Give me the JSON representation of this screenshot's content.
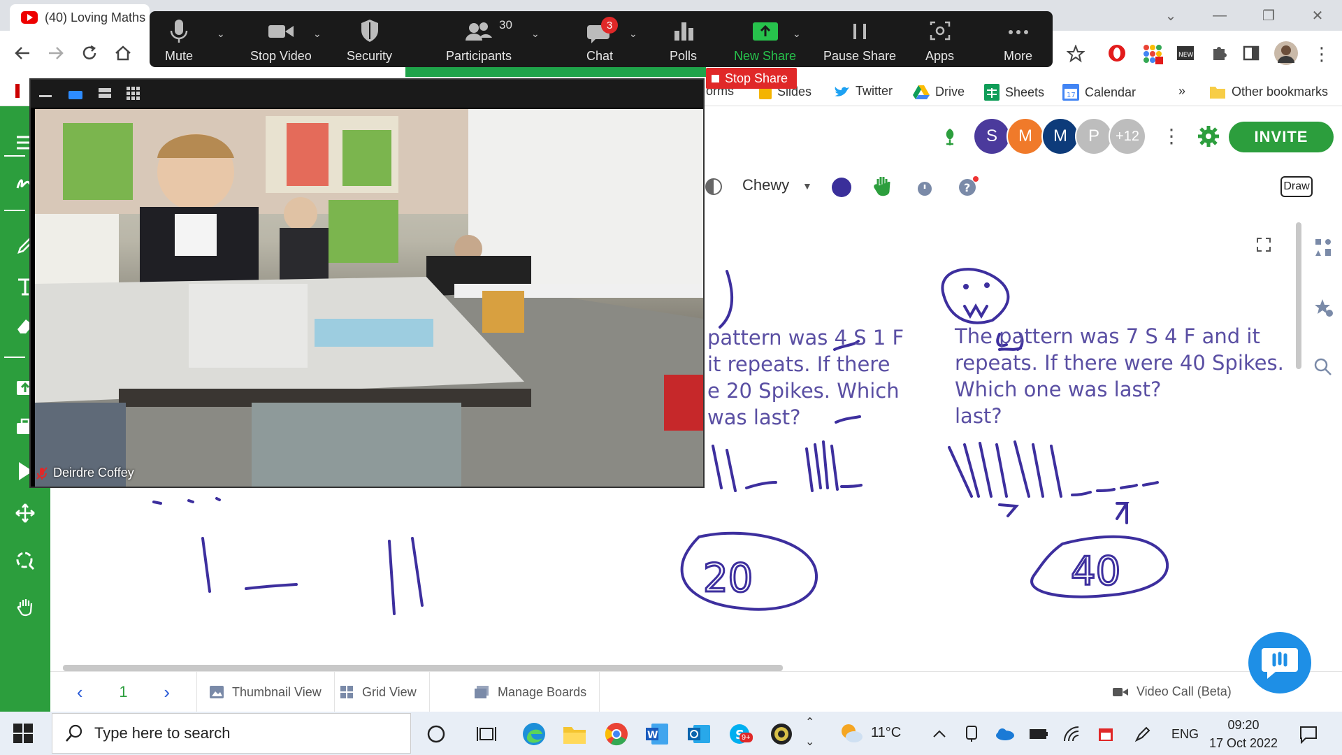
{
  "browser": {
    "tab_title": "(40) Loving Maths",
    "bookmarks": [
      "Slides",
      "Twitter",
      "Drive",
      "Sheets",
      "Calendar"
    ],
    "bookmarks_more": "»",
    "other_bookmarks": "Other bookmarks",
    "bm_partial_forms": "orms"
  },
  "zoom": {
    "mute": "Mute",
    "stop_video": "Stop Video",
    "security": "Security",
    "participants": "Participants",
    "participants_count": "30",
    "chat": "Chat",
    "chat_badge": "3",
    "polls": "Polls",
    "new_share": "New Share",
    "pause_share": "Pause Share",
    "apps": "Apps",
    "more": "More",
    "stop_share": "Stop Share",
    "video_name": "Deirdre Coffey"
  },
  "whiteboard": {
    "avatars": [
      {
        "letter": "S",
        "color": "#4b3a9c"
      },
      {
        "letter": "M",
        "color": "#f07a2a"
      },
      {
        "letter": "M",
        "color": "#0d3b7a"
      },
      {
        "letter": "P",
        "color": "#bdbdbd"
      },
      {
        "letter": "+12",
        "color": "#bdbdbd"
      }
    ],
    "invite": "INVITE",
    "font_name": "Chewy",
    "draw_button": "Draw",
    "problem1": [
      "pattern was 4 S 1 F",
      "it repeats. If there",
      "e 20 Spikes. Which",
      "was last?"
    ],
    "problem2": [
      "The pattern was 7 S 4 F and it",
      "repeats. If there were 40 Spikes.",
      " Which one was last?",
      "last?"
    ],
    "answer1": "20",
    "answer2": "40",
    "page_number": "1",
    "thumbnail_view": "Thumbnail View",
    "grid_view": "Grid View",
    "manage_boards": "Manage Boards",
    "video_call": "Video Call (Beta)"
  },
  "taskbar": {
    "search_placeholder": "Type here to search",
    "temperature": "11°C",
    "language": "ENG",
    "time": "09:20",
    "date": "17 Oct 2022",
    "skype_badge": "9+"
  }
}
